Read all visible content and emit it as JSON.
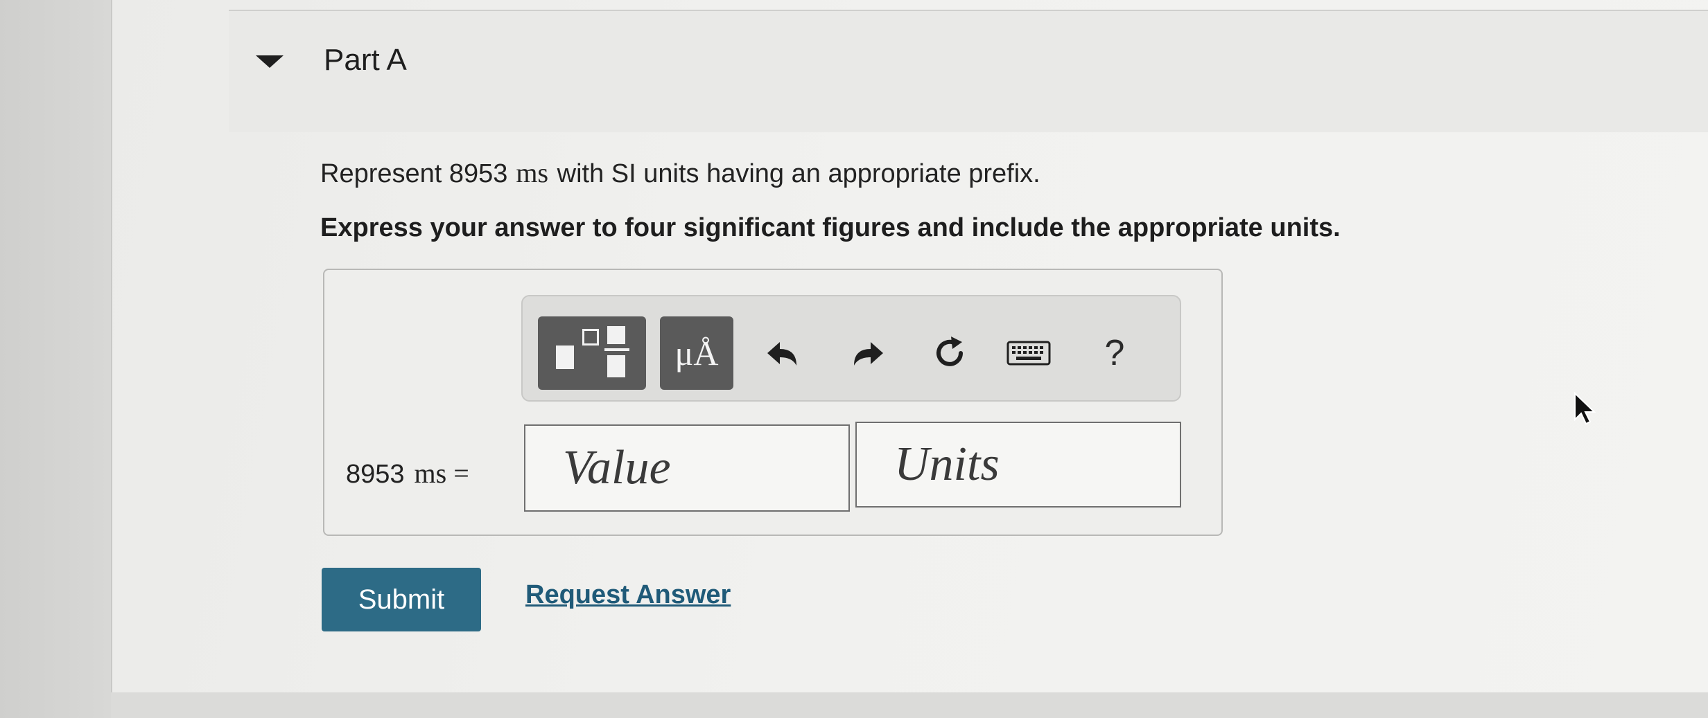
{
  "section": {
    "title": "Part A",
    "toggle_icon": "caret-down-icon"
  },
  "question": {
    "prompt_before": "Represent 8953",
    "prompt_unit": "ms",
    "prompt_after": "with SI units having an appropriate prefix.",
    "instruction": "Express your answer to four significant figures and include the appropriate units."
  },
  "toolbar": {
    "templates_icon": "templates-icon",
    "units_label": "μÅ",
    "undo_icon": "undo-icon",
    "redo_icon": "redo-icon",
    "reset_icon": "reset-icon",
    "keyboard_icon": "keyboard-icon",
    "help_label": "?"
  },
  "answer": {
    "lhs_value": "8953",
    "lhs_unit": "ms =",
    "value_placeholder": "Value",
    "units_placeholder": "Units"
  },
  "actions": {
    "submit_label": "Submit",
    "request_answer_label": "Request Answer"
  },
  "colors": {
    "submit_bg": "#2d6b86",
    "link": "#1f5a78",
    "toolbar_button_dark": "#5a5a5a"
  }
}
